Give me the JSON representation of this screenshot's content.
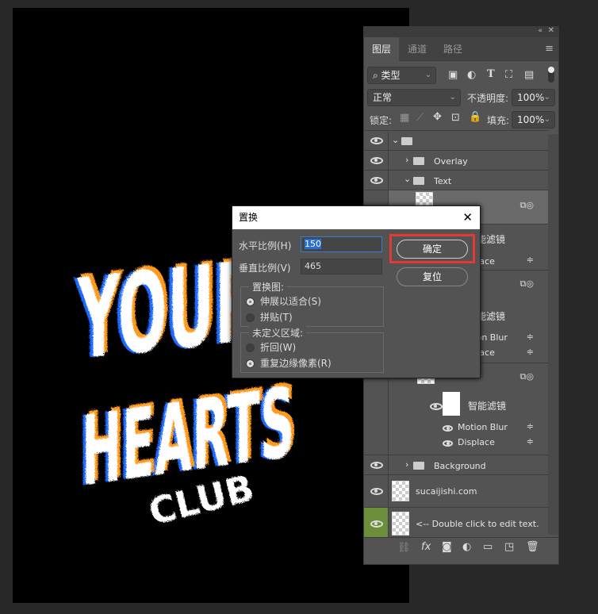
{
  "artwork": {
    "lines": [
      "YOUR",
      "HEARTS",
      "CLUB"
    ],
    "colors": {
      "main": "#ffffff",
      "shadow1": "#1f6bff",
      "shadow2": "#ff9a1a"
    }
  },
  "panel": {
    "tabs": [
      {
        "label": "图层",
        "active": true
      },
      {
        "label": "通道",
        "active": false
      },
      {
        "label": "路径",
        "active": false
      }
    ],
    "filter_kind": "类型",
    "blend_mode": "正常",
    "opacity_label": "不透明度:",
    "opacity": "100%",
    "lock_label": "锁定:",
    "fill_label": "填充:",
    "fill": "100%",
    "layers": {
      "overlay": "Overlay",
      "text": "Text",
      "smart_filters": "智能滤镜",
      "motion_blur": "Motion Blur",
      "displace": "Displace",
      "background": "Background",
      "sucai": "sucaijishi.com",
      "edit": "<-- Double click to edit text."
    },
    "active_color": "#6b8e3a"
  },
  "dialog": {
    "title": "置换",
    "close": "✕",
    "h_label": "水平比例(H)",
    "h_value": "150",
    "v_label": "垂直比例(V)",
    "v_value": "465",
    "map_group": "置换图:",
    "stretch": "伸展以适合(S)",
    "tile": "拼贴(T)",
    "undef_group": "未定义区域:",
    "wrap": "折回(W)",
    "repeat": "重复边缘像素(R)",
    "ok": "确定",
    "reset": "复位",
    "highlight_color": "#e53935"
  }
}
